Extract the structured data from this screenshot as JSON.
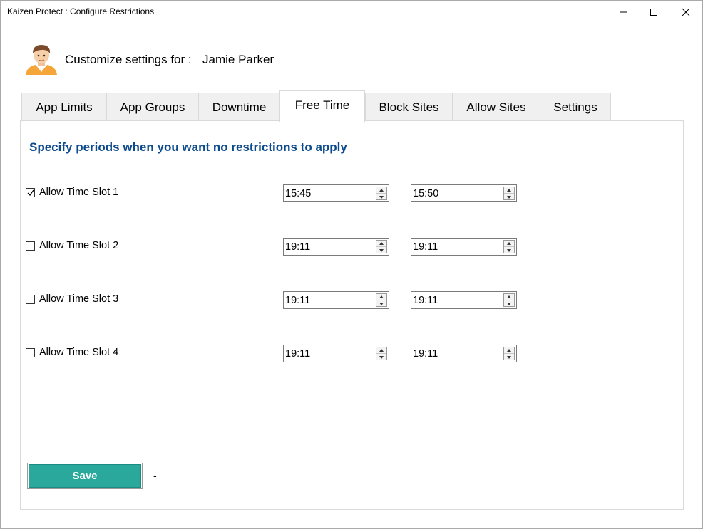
{
  "window": {
    "title": "Kaizen Protect : Configure Restrictions",
    "controls": {
      "minimize_icon": "minimize-icon",
      "maximize_icon": "maximize-icon",
      "close_icon": "close-icon"
    }
  },
  "header": {
    "customize_label": "Customize settings for :",
    "user_name": "Jamie Parker",
    "avatar_icon": "user-avatar"
  },
  "tabs": [
    {
      "label": "App Limits",
      "active": false
    },
    {
      "label": "App Groups",
      "active": false
    },
    {
      "label": "Downtime",
      "active": false
    },
    {
      "label": "Free Time",
      "active": true
    },
    {
      "label": "Block Sites",
      "active": false
    },
    {
      "label": "Allow Sites",
      "active": false
    },
    {
      "label": "Settings",
      "active": false
    }
  ],
  "free_time": {
    "heading": "Specify periods when you want no restrictions to apply",
    "slots": [
      {
        "label": "Allow Time Slot 1",
        "checked": true,
        "start": "15:45",
        "end": "15:50"
      },
      {
        "label": "Allow Time Slot 2",
        "checked": false,
        "start": "19:11",
        "end": "19:11"
      },
      {
        "label": "Allow Time Slot 3",
        "checked": false,
        "start": "19:11",
        "end": "19:11"
      },
      {
        "label": "Allow Time Slot 4",
        "checked": false,
        "start": "19:11",
        "end": "19:11"
      }
    ],
    "save_label": "Save",
    "status_text": "-"
  },
  "colors": {
    "heading": "#0c4a8c",
    "save_button": "#2aa89b",
    "tab_inactive": "#f0f0f0"
  }
}
